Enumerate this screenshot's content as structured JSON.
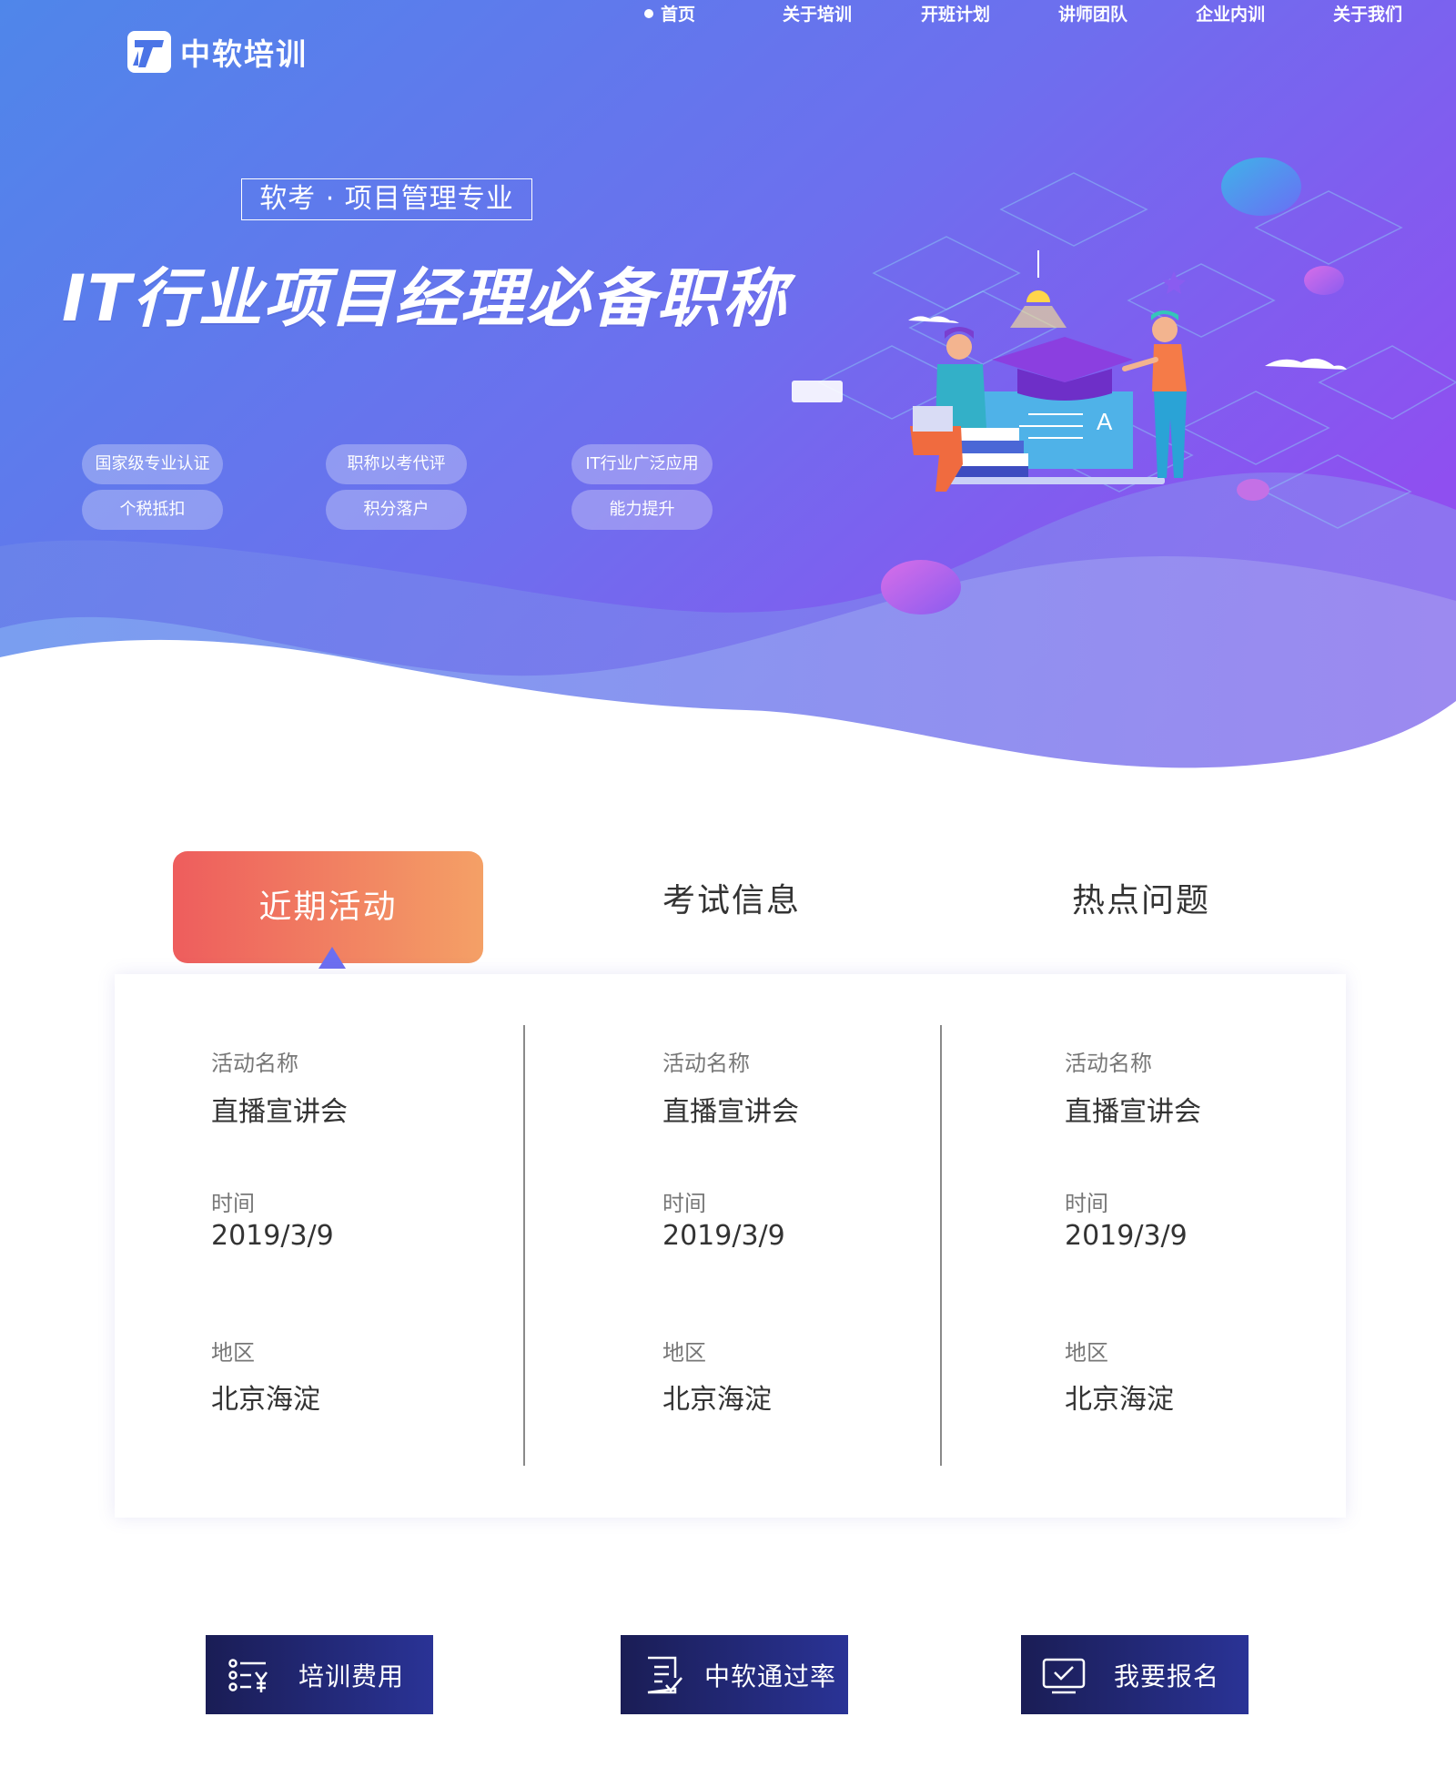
{
  "header": {
    "logo_text": "中软培训",
    "nav": [
      {
        "label": "首页",
        "active": true
      },
      {
        "label": "关于培训"
      },
      {
        "label": "开班计划"
      },
      {
        "label": "讲师团队"
      },
      {
        "label": "企业内训"
      },
      {
        "label": "关于我们"
      }
    ]
  },
  "hero": {
    "subtitle": "软考 · 项目管理专业",
    "title": "IT行业项目经理必备职称",
    "pills": [
      "国家级专业认证",
      "职称以考代评",
      "IT行业广泛应用",
      "个税抵扣",
      "积分落户",
      "能力提升"
    ]
  },
  "tabs": [
    {
      "label": "近期活动",
      "active": true
    },
    {
      "label": "考试信息"
    },
    {
      "label": "热点问题"
    }
  ],
  "events": [
    {
      "name_label": "活动名称",
      "name": "直播宣讲会",
      "time_label": "时间",
      "time": "2019/3/9",
      "region_label": "地区",
      "region": "北京海淀"
    },
    {
      "name_label": "活动名称",
      "name": "直播宣讲会",
      "time_label": "时间",
      "time": "2019/3/9",
      "region_label": "地区",
      "region": "北京海淀"
    },
    {
      "name_label": "活动名称",
      "name": "直播宣讲会",
      "time_label": "时间",
      "time": "2019/3/9",
      "region_label": "地区",
      "region": "北京海淀"
    }
  ],
  "actions": [
    {
      "label": "培训费用",
      "icon": "fee-list-icon"
    },
    {
      "label": "中软通过率",
      "icon": "document-check-icon"
    },
    {
      "label": "我要报名",
      "icon": "monitor-check-icon"
    }
  ],
  "colors": {
    "hero_start": "#4f86ea",
    "hero_end": "#8f4ff0",
    "tab_active_start": "#ee5d5d",
    "tab_active_end": "#f4a066",
    "button_dark": "#1a1d55",
    "button_light": "#2a3396"
  }
}
